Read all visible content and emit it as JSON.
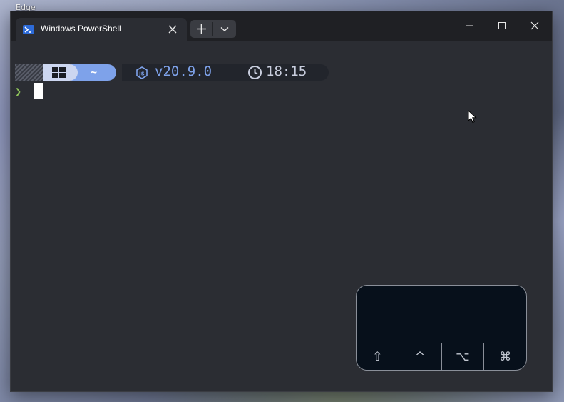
{
  "desktop": {
    "icon_label_1": "Edge"
  },
  "window": {
    "tab_title": "Windows PowerShell",
    "accent_color": "#2d6bd8"
  },
  "prompt": {
    "path": "~",
    "node_version": "v20.9.0",
    "time": "18:15",
    "chevron": "❯",
    "colors": {
      "os_segment": "#ccd6f0",
      "path_segment": "#7ea2ea",
      "node_text": "#7ea2ea",
      "chevron": "#8fc45a"
    }
  },
  "touchpad": {
    "keys": [
      "⇧",
      "^",
      "⌥",
      "⌘"
    ]
  }
}
